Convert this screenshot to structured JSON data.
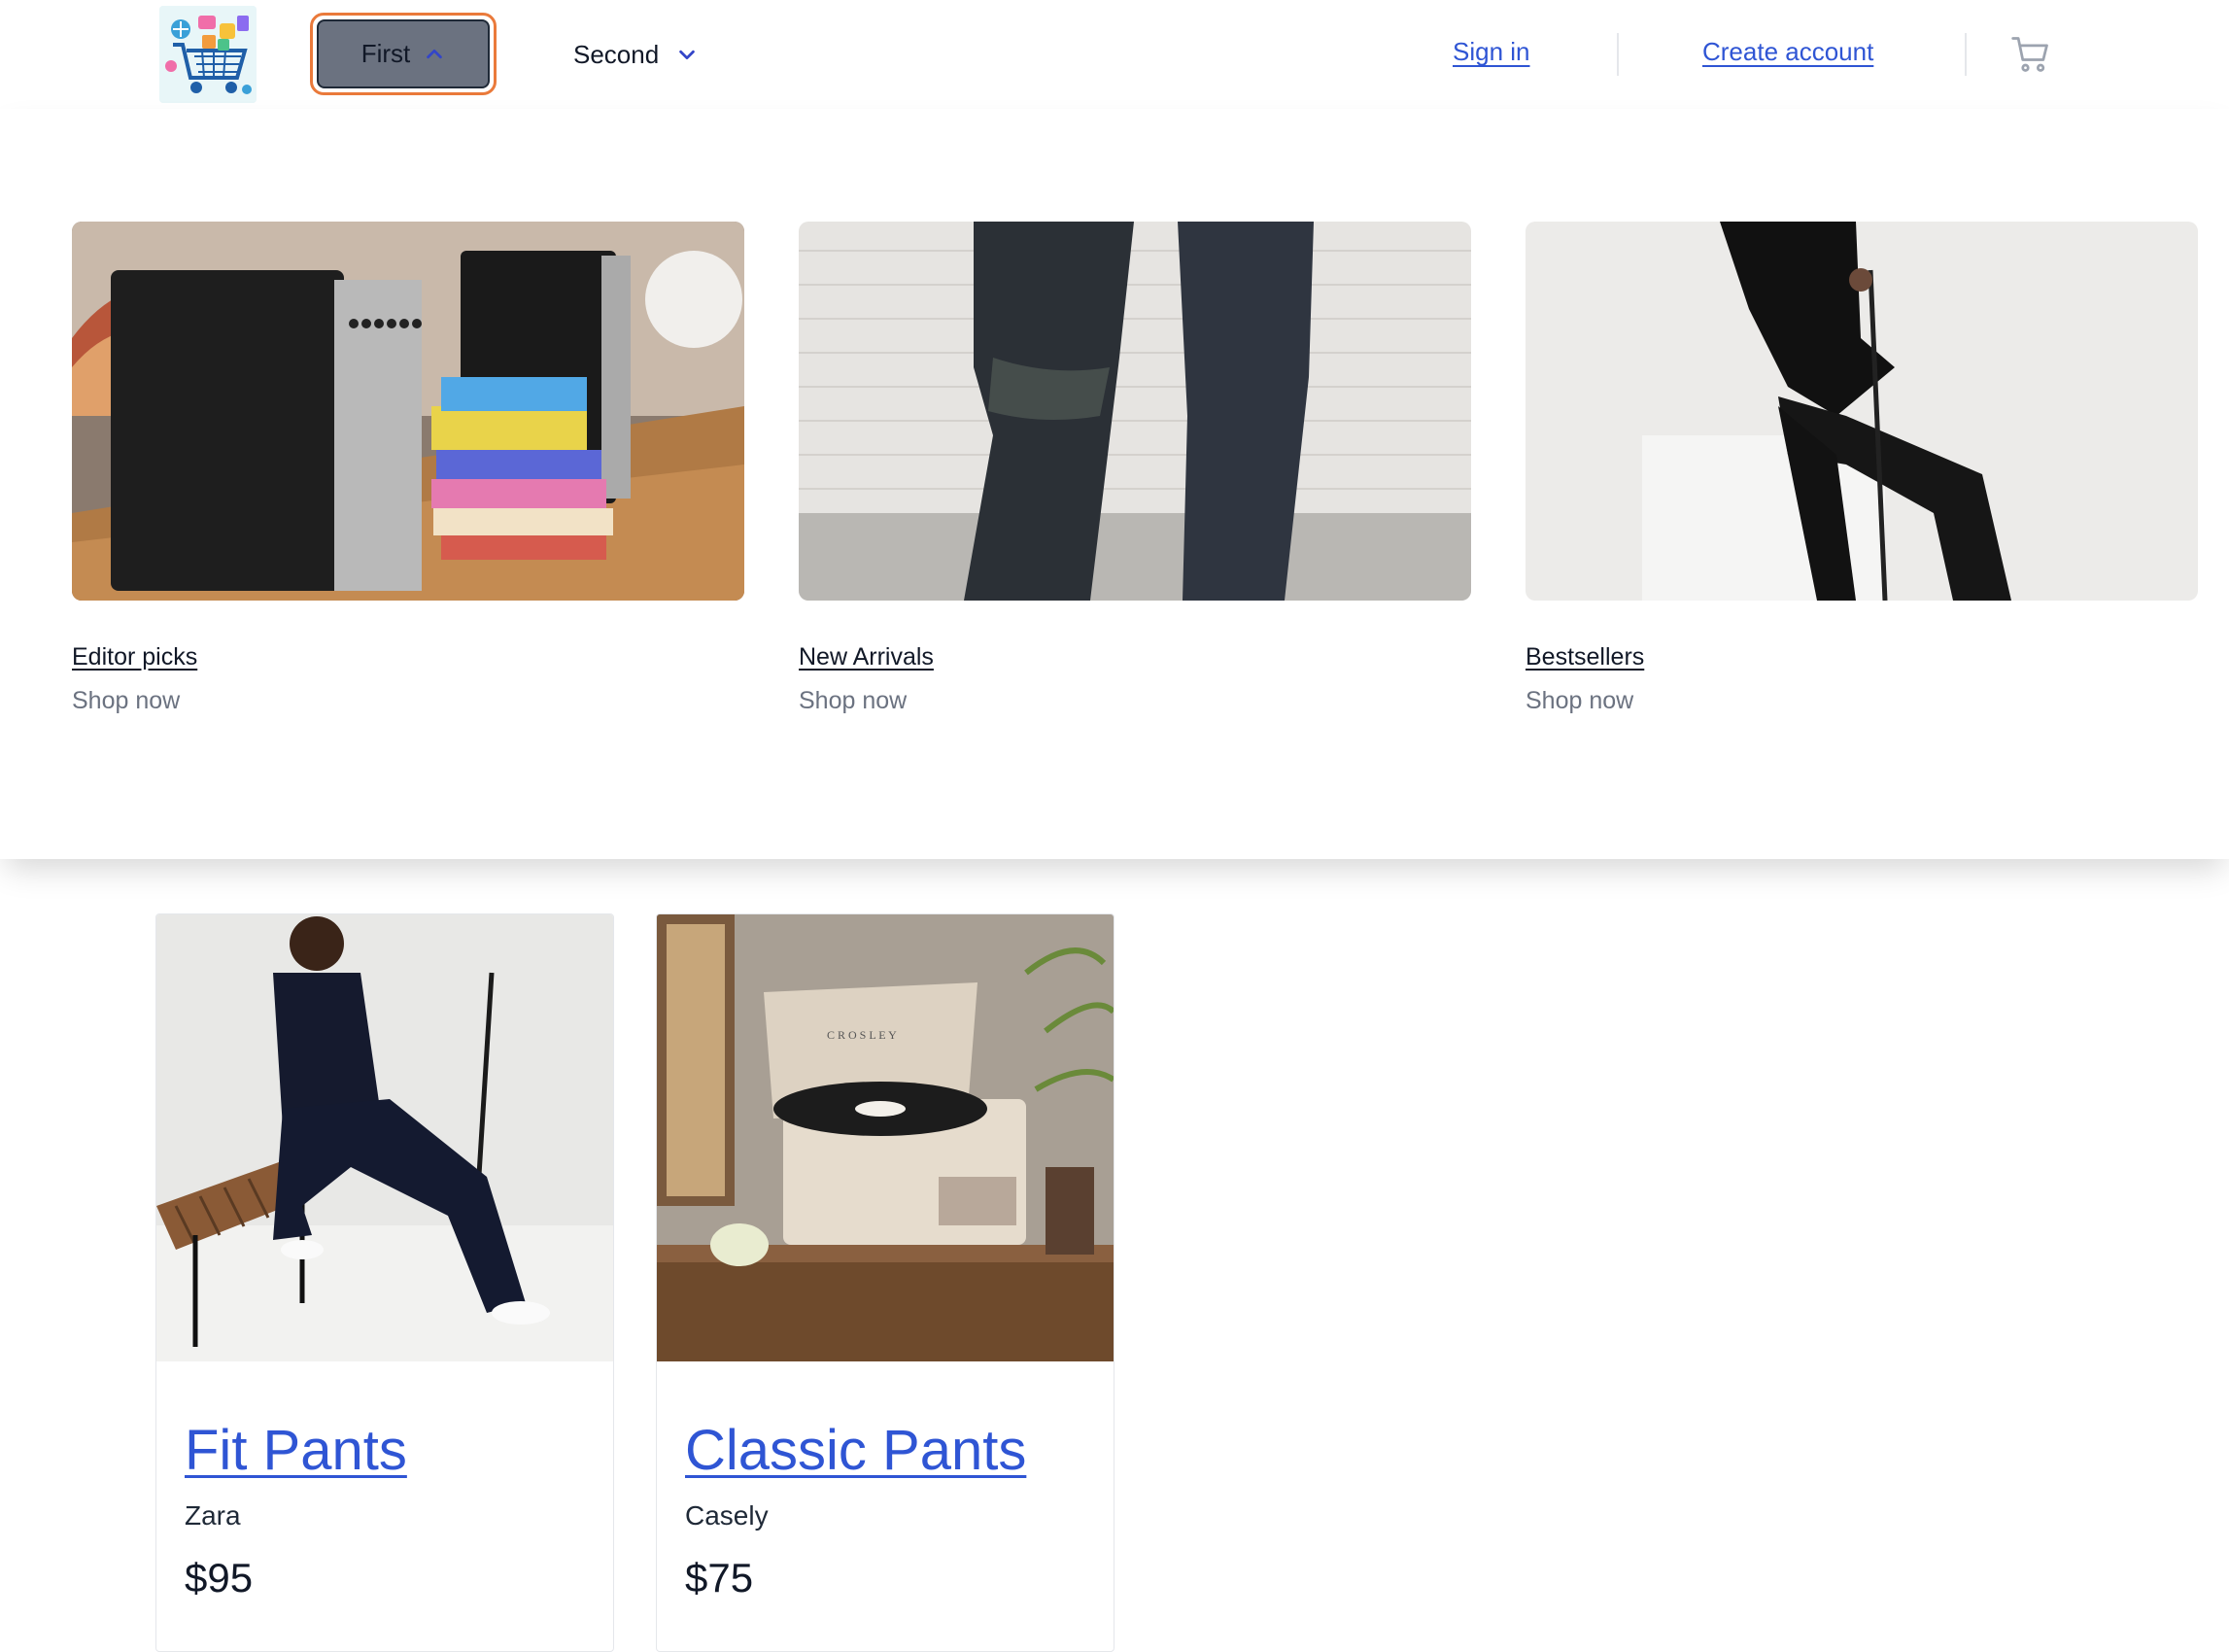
{
  "header": {
    "logo_alt": "Shop logo",
    "flyouts": [
      {
        "label": "First",
        "state": "open"
      },
      {
        "label": "Second",
        "state": "closed"
      }
    ],
    "sign_in": "Sign in",
    "create_account": "Create account",
    "cart_icon": "shopping-cart-icon"
  },
  "categories": [
    {
      "title": "Editor picks",
      "subtitle": "Shop now",
      "image": "speakers-and-books"
    },
    {
      "title": "New Arrivals",
      "subtitle": "Shop now",
      "image": "denim-jeans"
    },
    {
      "title": "Bestsellers",
      "subtitle": "Shop now",
      "image": "man-black-polo"
    }
  ],
  "products": [
    {
      "name": "Fit Pants",
      "brand": "Zara",
      "price": "$95",
      "image": "man-on-bench"
    },
    {
      "name": "Classic Pants",
      "brand": "Casely",
      "price": "$75",
      "image": "record-player"
    }
  ],
  "colors": {
    "link": "#2f55d4",
    "focus_ring": "#ea7a3b",
    "flyout_open_bg": "#6b7280",
    "muted_text": "#6b7280"
  }
}
